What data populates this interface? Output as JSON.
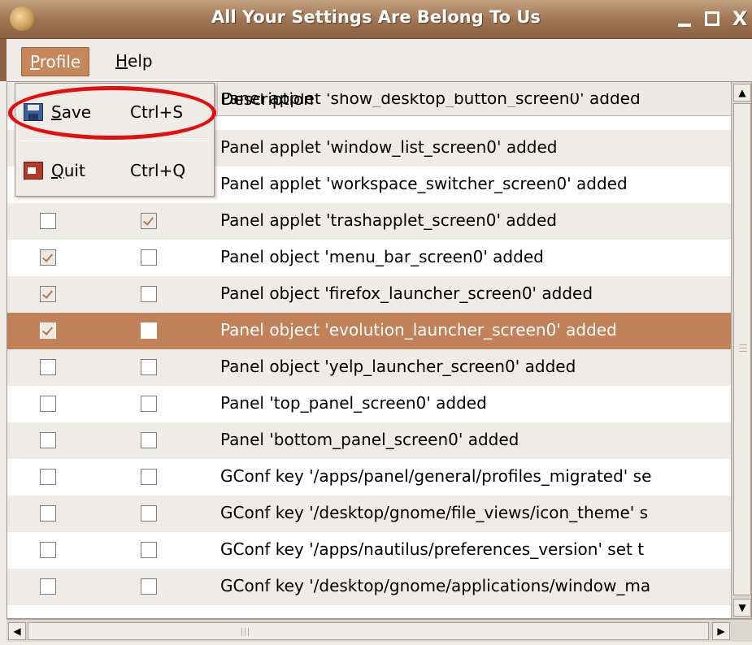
{
  "window": {
    "title": "All Your Settings Are Belong To Us",
    "buttons": {
      "minimize": "",
      "maximize": "",
      "close": "X"
    },
    "app_icon": "ubuntu-logo-icon"
  },
  "menubar": {
    "items": [
      {
        "label": "Profile",
        "mnemonic": "P",
        "rest": "rofile",
        "active": true
      },
      {
        "label": "Help",
        "mnemonic": "H",
        "rest": "elp",
        "active": false
      }
    ]
  },
  "profile_menu": {
    "items": [
      {
        "label": "Save",
        "mnemonic": "S",
        "rest": "ave",
        "accel": "Ctrl+S",
        "icon": "floppy-disk-icon",
        "highlighted": true
      },
      {
        "label": "Quit",
        "mnemonic": "Q",
        "rest": "uit",
        "accel": "Ctrl+Q",
        "icon": "quit-icon"
      }
    ]
  },
  "table": {
    "columns": [
      "",
      "",
      "Description"
    ],
    "rows": [
      {
        "c1": false,
        "c2": false,
        "desc": "Panel applet 'show_desktop_button_screen0' added",
        "partial": true
      },
      {
        "c1": false,
        "c2": false,
        "desc": "Panel applet 'window_list_screen0' added"
      },
      {
        "c1": false,
        "c2": true,
        "desc": "Panel applet 'workspace_switcher_screen0' added"
      },
      {
        "c1": false,
        "c2": true,
        "desc": "Panel applet 'trashapplet_screen0' added"
      },
      {
        "c1": true,
        "c2": false,
        "desc": "Panel object 'menu_bar_screen0' added"
      },
      {
        "c1": true,
        "c2": false,
        "desc": "Panel object 'firefox_launcher_screen0' added"
      },
      {
        "c1": true,
        "c2": false,
        "desc": "Panel object 'evolution_launcher_screen0' added",
        "selected": true
      },
      {
        "c1": false,
        "c2": false,
        "desc": "Panel object 'yelp_launcher_screen0' added"
      },
      {
        "c1": false,
        "c2": false,
        "desc": "Panel 'top_panel_screen0' added"
      },
      {
        "c1": false,
        "c2": false,
        "desc": "Panel 'bottom_panel_screen0' added"
      },
      {
        "c1": false,
        "c2": false,
        "desc": "GConf key '/apps/panel/general/profiles_migrated' se"
      },
      {
        "c1": false,
        "c2": false,
        "desc": "GConf key '/desktop/gnome/file_views/icon_theme' s"
      },
      {
        "c1": false,
        "c2": false,
        "desc": "GConf key '/apps/nautilus/preferences_version' set t"
      },
      {
        "c1": false,
        "c2": false,
        "desc": "GConf key '/desktop/gnome/applications/window_ma"
      }
    ]
  },
  "colors": {
    "accent": "#c1825a",
    "highlight_ring": "#e30e0e",
    "titlebar": "#9d7352"
  }
}
